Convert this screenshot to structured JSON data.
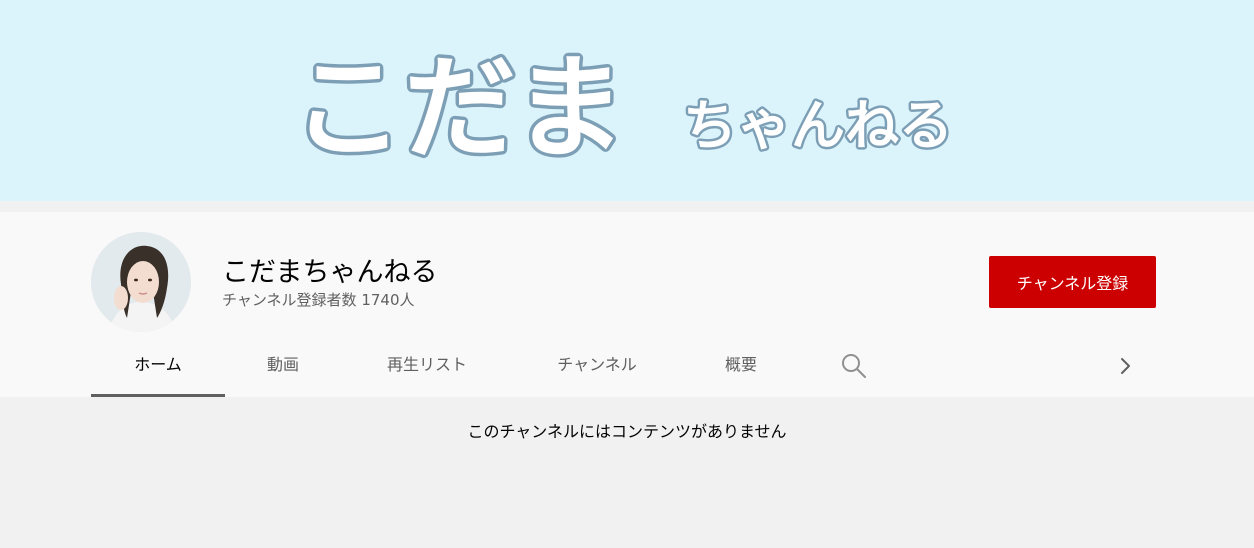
{
  "banner": {
    "title_large": "こだま",
    "title_small": "ちゃんねる"
  },
  "channel": {
    "name": "こだまちゃんねる",
    "subscribers": "チャンネル登録者数 1740人",
    "subscribe_label": "チャンネル登録"
  },
  "tabs": [
    {
      "label": "ホーム",
      "active": true
    },
    {
      "label": "動画"
    },
    {
      "label": "再生リスト"
    },
    {
      "label": "チャンネル"
    },
    {
      "label": "概要"
    }
  ],
  "icons": {
    "search": "search-icon",
    "next": "chevron-right-icon"
  },
  "content": {
    "empty_message": "このチャンネルにはコンテンツがありません"
  },
  "colors": {
    "banner_bg": "#dbf4fc",
    "banner_text": "#ffffff",
    "banner_outline": "#7d9fb6",
    "subscribe_bg": "#cc0000"
  }
}
